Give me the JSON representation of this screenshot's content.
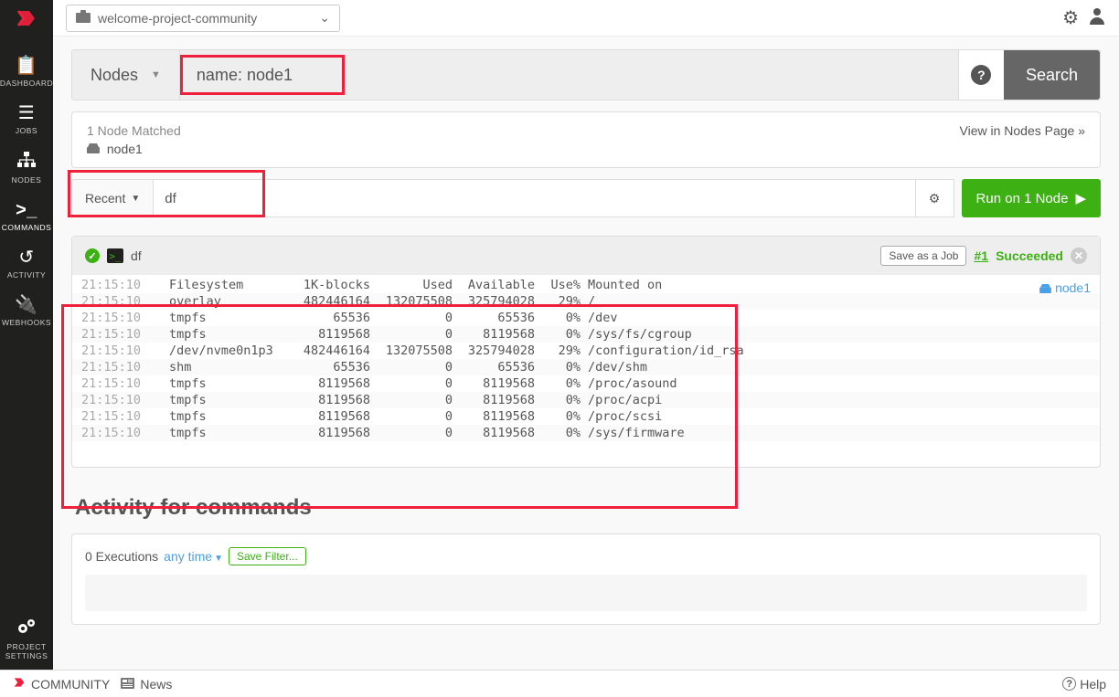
{
  "project_name": "welcome-project-community",
  "sidebar": {
    "items": [
      {
        "label": "DASHBOARD",
        "icon": "clipboard"
      },
      {
        "label": "JOBS",
        "icon": "list"
      },
      {
        "label": "NODES",
        "icon": "sitemap"
      },
      {
        "label": "COMMANDS",
        "icon": "terminal",
        "active": true
      },
      {
        "label": "ACTIVITY",
        "icon": "history"
      },
      {
        "label": "WEBHOOKS",
        "icon": "plug"
      }
    ],
    "settings_label": "PROJECT SETTINGS"
  },
  "search": {
    "dropdown_label": "Nodes",
    "input_value": "name: node1",
    "button_label": "Search"
  },
  "match": {
    "summary": "1 Node Matched",
    "node_name": "node1",
    "view_link": "View in Nodes Page »"
  },
  "command": {
    "recent_label": "Recent",
    "input_value": "df",
    "run_label": "Run on 1 Node"
  },
  "output": {
    "cmd": "df",
    "save_job": "Save as a Job",
    "exec_id": "#1",
    "status": "Succeeded",
    "node": "node1",
    "header": {
      "ts": "21:15:10",
      "fs": "Filesystem",
      "k": "1K-blocks",
      "used": "Used",
      "avail": "Available",
      "pct": "Use%",
      "mnt": "Mounted on"
    },
    "rows": [
      {
        "ts": "21:15:10",
        "fs": "overlay",
        "k": "482446164",
        "used": "132075508",
        "avail": "325794028",
        "pct": "29%",
        "mnt": "/"
      },
      {
        "ts": "21:15:10",
        "fs": "tmpfs",
        "k": "65536",
        "used": "0",
        "avail": "65536",
        "pct": "0%",
        "mnt": "/dev"
      },
      {
        "ts": "21:15:10",
        "fs": "tmpfs",
        "k": "8119568",
        "used": "0",
        "avail": "8119568",
        "pct": "0%",
        "mnt": "/sys/fs/cgroup"
      },
      {
        "ts": "21:15:10",
        "fs": "/dev/nvme0n1p3",
        "k": "482446164",
        "used": "132075508",
        "avail": "325794028",
        "pct": "29%",
        "mnt": "/configuration/id_rsa"
      },
      {
        "ts": "21:15:10",
        "fs": "shm",
        "k": "65536",
        "used": "0",
        "avail": "65536",
        "pct": "0%",
        "mnt": "/dev/shm"
      },
      {
        "ts": "21:15:10",
        "fs": "tmpfs",
        "k": "8119568",
        "used": "0",
        "avail": "8119568",
        "pct": "0%",
        "mnt": "/proc/asound"
      },
      {
        "ts": "21:15:10",
        "fs": "tmpfs",
        "k": "8119568",
        "used": "0",
        "avail": "8119568",
        "pct": "0%",
        "mnt": "/proc/acpi"
      },
      {
        "ts": "21:15:10",
        "fs": "tmpfs",
        "k": "8119568",
        "used": "0",
        "avail": "8119568",
        "pct": "0%",
        "mnt": "/proc/scsi"
      },
      {
        "ts": "21:15:10",
        "fs": "tmpfs",
        "k": "8119568",
        "used": "0",
        "avail": "8119568",
        "pct": "0%",
        "mnt": "/sys/firmware"
      }
    ]
  },
  "activity": {
    "heading": "Activity for commands",
    "executions": "0 Executions",
    "anytime": "any time",
    "save_filter": "Save Filter..."
  },
  "footer": {
    "brand": "COMMUNITY",
    "news": "News",
    "help": "Help"
  }
}
